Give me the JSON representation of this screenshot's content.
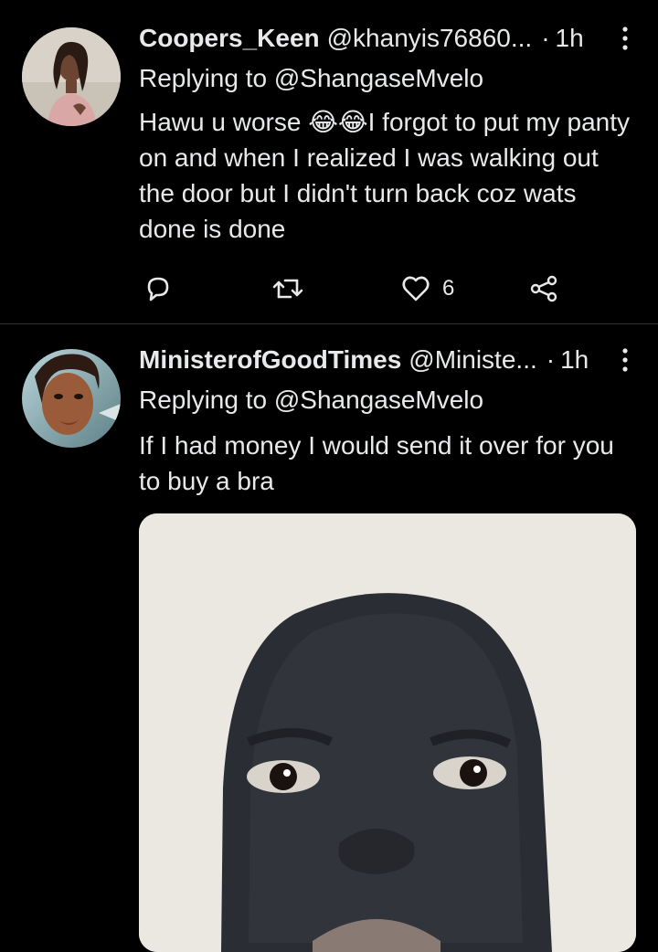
{
  "tweets": [
    {
      "author_name": "Coopers_Keen",
      "handle": "@khanyis76860...",
      "separator": "·",
      "time": "1h",
      "replying_to": "Replying to @ShangaseMvelo",
      "text_before_emoji": "Hawu u worse ",
      "emoji": "😂😂",
      "text_after_emoji": "I forgot to put my panty on and when I realized I was walking out the door but I didn't turn back coz wats done is done",
      "actions": {
        "likes": "6"
      },
      "avatar_icon": "woman-portrait-avatar"
    },
    {
      "author_name": "MinisterofGoodTimes",
      "handle": "@Ministe...",
      "separator": "·",
      "time": "1h",
      "replying_to": "Replying to @ShangaseMvelo",
      "text": "If I had money I would send it over for you to buy a bra",
      "media_icon": "face-mask-photo",
      "avatar_icon": "woman-face-avatar"
    }
  ],
  "colors": {
    "background": "#000000",
    "text": "#e7e9ea",
    "divider": "#2f3336",
    "icon": "#e7e9ea"
  }
}
